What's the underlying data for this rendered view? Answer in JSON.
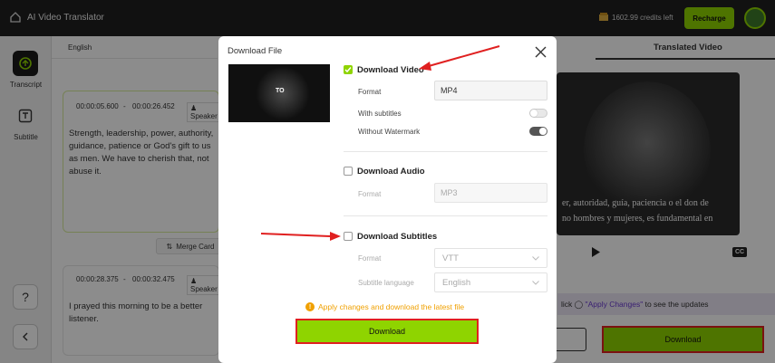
{
  "app": {
    "title": "AI Video Translator",
    "credits": "1602.99 credits left",
    "recharge": "Recharge"
  },
  "sidebar": {
    "items": [
      {
        "label": "Transcript"
      },
      {
        "label": "Subtitle"
      }
    ]
  },
  "panel": {
    "language": "English",
    "right_tab": "Translated Video",
    "merge_label": "Merge Card",
    "segments": [
      {
        "start": "00:00:05.600",
        "sep": "-",
        "end": "00:00:26.452",
        "speaker": "Speaker",
        "text": "Strength, leadership, power, authority, guidance, patience or God's gift to us as men. We have to cherish that, not abuse it."
      },
      {
        "start": "00:00:28.375",
        "sep": "-",
        "end": "00:00:32.475",
        "speaker": "Speaker",
        "text": "I prayed this morning to be a better listener."
      }
    ],
    "video_subtitle": "er, autoridad, guía, paciencia o el don de\nno hombres y mujeres, es fundamental en",
    "cc": "CC",
    "apply_hint_pre": "lick",
    "apply_hint_link": "\"Apply Changes\"",
    "apply_hint_post": "to see the updates",
    "download_label": "Download"
  },
  "modal": {
    "title": "Download File",
    "thumb_text": "TO",
    "video": {
      "label": "Download Video",
      "checked": true,
      "format_label": "Format",
      "format_value": "MP4",
      "subs_label": "With subtitles",
      "subs_on": false,
      "wm_label": "Without Watermark",
      "wm_on": true
    },
    "audio": {
      "label": "Download Audio",
      "checked": false,
      "format_label": "Format",
      "format_value": "MP3"
    },
    "subtitles": {
      "label": "Download Subtitles",
      "checked": false,
      "format_label": "Format",
      "format_value": "VTT",
      "lang_label": "Subtitle language",
      "lang_value": "English"
    },
    "note": "Apply changes and download the latest file",
    "download_label": "Download"
  },
  "colors": {
    "accent": "#8fd400",
    "annotation": "#e02020",
    "warning": "#f0a000"
  }
}
